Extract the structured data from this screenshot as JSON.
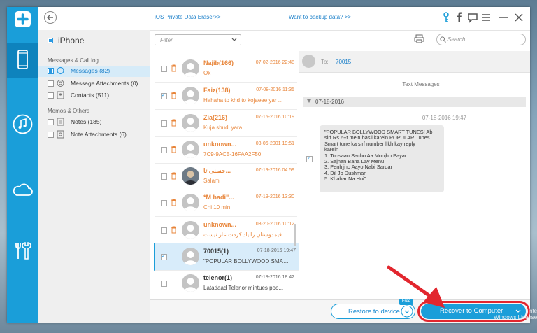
{
  "topbar": {
    "link1": "iOS Private Data Eraser>>",
    "link2": "Want to backup data? >>"
  },
  "categories": {
    "device": "iPhone",
    "group1": "Messages & Call log",
    "group2": "Memos & Others",
    "items": [
      {
        "label": "Messages (82)",
        "checked": true,
        "active": true
      },
      {
        "label": "Message Attachments (0)",
        "checked": false
      },
      {
        "label": "Contacts (511)",
        "checked": false
      },
      {
        "label": "Notes (185)",
        "checked": false
      },
      {
        "label": "Note Attachments (6)",
        "checked": false
      }
    ]
  },
  "list": {
    "filter_placeholder": "Filter",
    "rows": [
      {
        "name": "Najib(166)",
        "date": "07-02-2016 22:48",
        "preview": "Ok",
        "deleted": true,
        "checked": false
      },
      {
        "name": "Faiz(138)",
        "date": "07-08-2016 11:35",
        "preview": "Hahaha to khd to kojaeee yar ...",
        "deleted": true,
        "checked": true
      },
      {
        "name": "Zia(216)",
        "date": "07-15-2016 10:19",
        "preview": "Kuja shudi yara",
        "deleted": true,
        "checked": false
      },
      {
        "name": "unknown...",
        "date": "03-06-2001 19:51",
        "preview": "7C9-9AC5-16FAA2F50",
        "deleted": true,
        "checked": false
      },
      {
        "name": "حسنی تا...",
        "date": "07-19-2016 04:59",
        "preview": "Salam",
        "deleted": true,
        "checked": false
      },
      {
        "name": "*M hadi\"...",
        "date": "07-19-2016 13:30",
        "preview": "Chi 10 min",
        "deleted": true,
        "checked": false
      },
      {
        "name": "unknown...",
        "date": "03-20-2016 10:12",
        "preview": "قیمدوستان را یاد کردت عار نیست...",
        "deleted": true,
        "checked": false
      },
      {
        "name": "70015(1)",
        "date": "07-18-2016 19:47",
        "preview": "\"POPULAR BOLLYWOOD SMAR...",
        "deleted": false,
        "checked": true
      },
      {
        "name": "telenor(1)",
        "date": "07-18-2016 18:42",
        "preview": "Latadaad Telenor mintues poo...",
        "deleted": false,
        "checked": false
      }
    ]
  },
  "detail": {
    "search_placeholder": "Search",
    "to_label": "To:",
    "to_number": "70015",
    "section": "Text Messages",
    "date": "07-18-2016",
    "timestamp": "07-18-2016 19:47",
    "message_lines": [
      "\"POPULAR BOLLYWOOD SMART TUNES! Ab",
      "sirf Rs.6+t mein hasil karein POPULAR Tunes.",
      "Smart tune ka sirf number likh kay reply",
      "karein",
      "1. Tonsaan Sacho Aa Monjho Payar",
      "2. Sajnan Bana Lay Menu",
      "3. Penhjjho Aayo Nabi Sardar",
      "4. Dil Jo Dushman",
      "5. Khabar Na Hui\""
    ]
  },
  "bottom": {
    "restore": "Restore to device",
    "free_badge": "Free",
    "recover": "Recover to Computer"
  },
  "watermark": {
    "line1": "nte",
    "line2": "Windows License"
  },
  "colors": {
    "accent": "#1a9ed9",
    "deleted": "#e8853a",
    "highlight": "#e2262e"
  }
}
